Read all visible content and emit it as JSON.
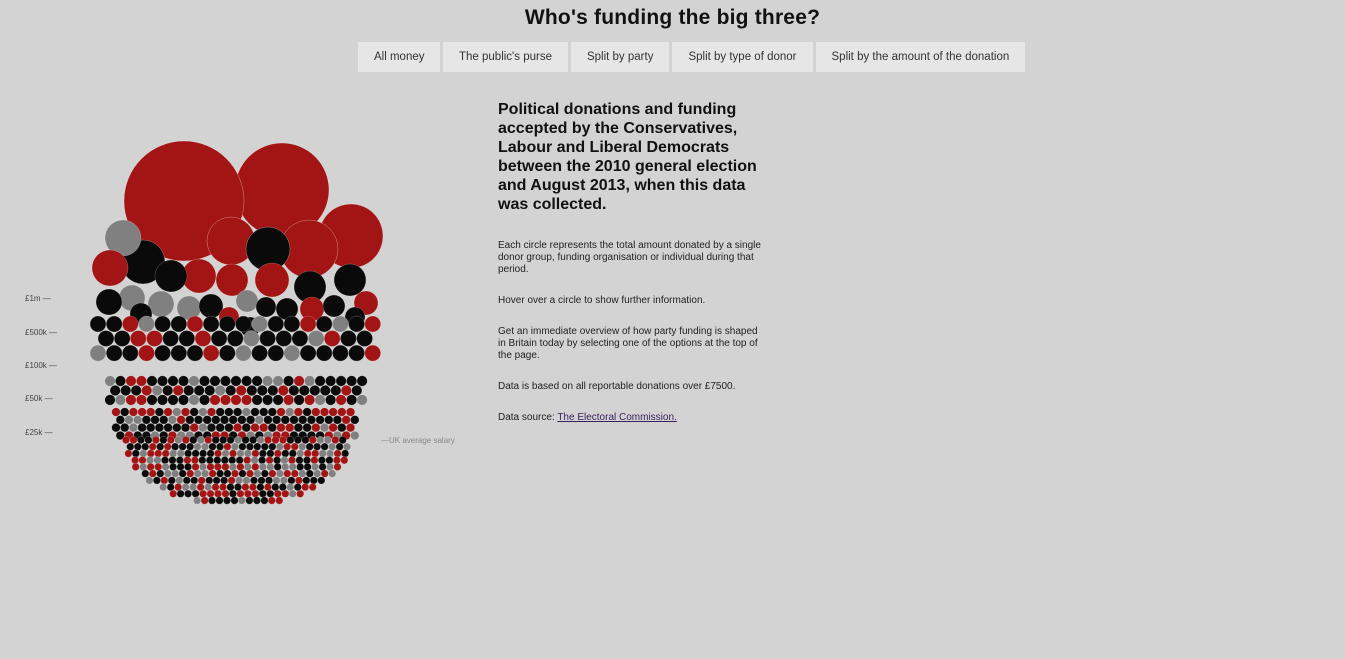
{
  "header": {
    "title": "Who's funding the big three?"
  },
  "tabs": [
    {
      "label": "All money"
    },
    {
      "label": "The public's purse"
    },
    {
      "label": "Split by party"
    },
    {
      "label": "Split by type of donor"
    },
    {
      "label": "Split by the amount of the donation"
    }
  ],
  "chart": {
    "scale_labels": [
      "£1m —",
      "£500k —",
      "£100k —",
      "£50k —",
      "£25k —"
    ],
    "salary_label": "—UK average salary",
    "colors": {
      "red": "#a31515",
      "black": "#0a0a0a",
      "grey": "#808080",
      "stroke": "#ffffff"
    }
  },
  "intro": {
    "heading": "Political donations and funding accepted by the Conservatives, Labour and Liberal Democrats between the 2010 general election and August 2013, when this data was collected.",
    "paragraphs": [
      "Each circle represents the total amount donated by a single donor group, funding organisation or individual during that period.",
      "Hover over a circle to show further information.",
      "Get an immediate overview of how party funding is shaped in Britain today by selecting one of the options at the top of the page.",
      "Data is based on all reportable donations over £7500."
    ],
    "source_label": "Data source:",
    "source_link": "The Electoral Commission."
  }
}
